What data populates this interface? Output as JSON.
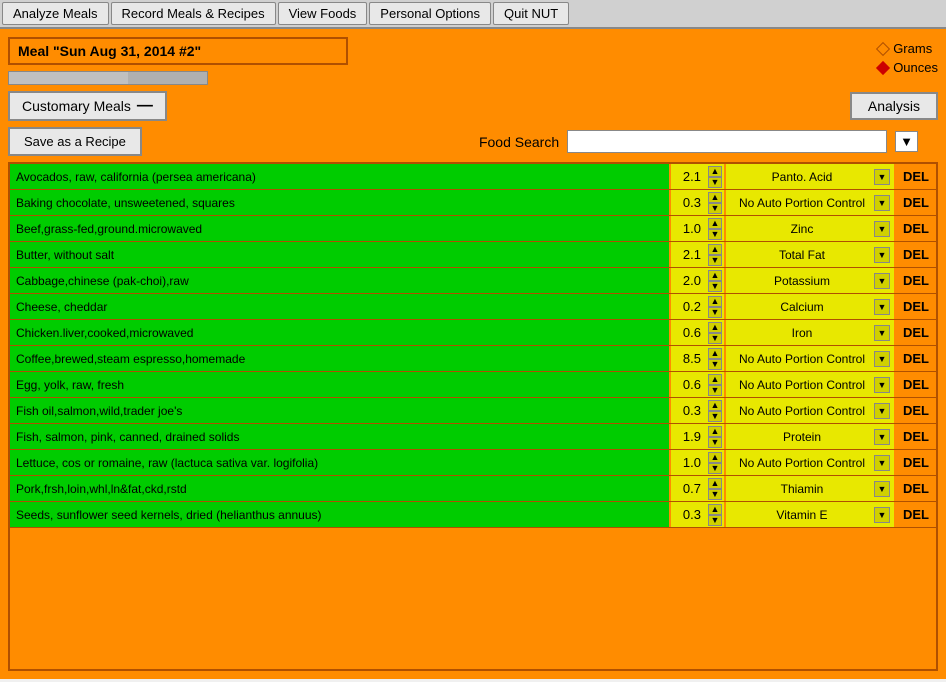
{
  "menu": {
    "items": [
      {
        "label": "Analyze Meals",
        "id": "analyze-meals"
      },
      {
        "label": "Record Meals & Recipes",
        "id": "record-meals"
      },
      {
        "label": "View Foods",
        "id": "view-foods"
      },
      {
        "label": "Personal Options",
        "id": "personal-options"
      },
      {
        "label": "Quit NUT",
        "id": "quit-nut"
      }
    ]
  },
  "meal_title": "Meal \"Sun Aug 31, 2014 #2\"",
  "units": {
    "grams_label": "Grams",
    "ounces_label": "Ounces"
  },
  "customary_meals_label": "Customary Meals",
  "analysis_label": "Analysis",
  "save_recipe_label": "Save as a Recipe",
  "food_search_label": "Food Search",
  "food_search_placeholder": "",
  "foods": [
    {
      "name": "Avocados, raw, california (persea americana)",
      "qty": "2.1",
      "nutrient": "Panto. Acid"
    },
    {
      "name": "Baking chocolate, unsweetened, squares",
      "qty": "0.3",
      "nutrient": "No Auto Portion Control"
    },
    {
      "name": "Beef,grass-fed,ground.microwaved",
      "qty": "1.0",
      "nutrient": "Zinc"
    },
    {
      "name": "Butter, without salt",
      "qty": "2.1",
      "nutrient": "Total Fat"
    },
    {
      "name": "Cabbage,chinese (pak-choi),raw",
      "qty": "2.0",
      "nutrient": "Potassium"
    },
    {
      "name": "Cheese, cheddar",
      "qty": "0.2",
      "nutrient": "Calcium"
    },
    {
      "name": "Chicken.liver,cooked,microwaved",
      "qty": "0.6",
      "nutrient": "Iron"
    },
    {
      "name": "Coffee,brewed,steam espresso,homemade",
      "qty": "8.5",
      "nutrient": "No Auto Portion Control"
    },
    {
      "name": "Egg, yolk, raw, fresh",
      "qty": "0.6",
      "nutrient": "No Auto Portion Control"
    },
    {
      "name": "Fish oil,salmon,wild,trader joe's",
      "qty": "0.3",
      "nutrient": "No Auto Portion Control"
    },
    {
      "name": "Fish, salmon, pink, canned, drained solids",
      "qty": "1.9",
      "nutrient": "Protein"
    },
    {
      "name": "Lettuce, cos or romaine, raw (lactuca sativa var. logifolia)",
      "qty": "1.0",
      "nutrient": "No Auto Portion Control"
    },
    {
      "name": "Pork,frsh,loin,whl,ln&fat,ckd,rstd",
      "qty": "0.7",
      "nutrient": "Thiamin"
    },
    {
      "name": "Seeds, sunflower seed kernels, dried (helianthus annuus)",
      "qty": "0.3",
      "nutrient": "Vitamin E"
    }
  ],
  "del_label": "DEL"
}
